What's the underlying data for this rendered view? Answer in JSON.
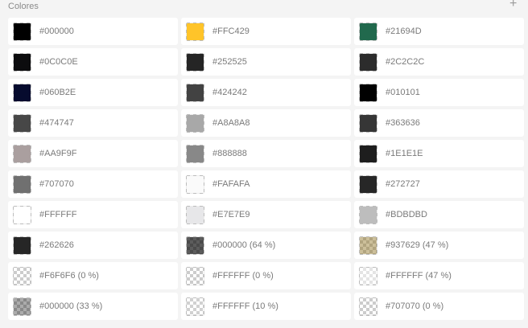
{
  "header": {
    "title": "Colores",
    "add_icon": "plus-icon"
  },
  "colors": [
    {
      "label": "#000000",
      "hex": "#000000",
      "alpha": 1
    },
    {
      "label": "#FFC429",
      "hex": "#FFC429",
      "alpha": 1
    },
    {
      "label": "#21694D",
      "hex": "#21694D",
      "alpha": 1
    },
    {
      "label": "#0C0C0E",
      "hex": "#0C0C0E",
      "alpha": 1
    },
    {
      "label": "#252525",
      "hex": "#252525",
      "alpha": 1
    },
    {
      "label": "#2C2C2C",
      "hex": "#2C2C2C",
      "alpha": 1
    },
    {
      "label": "#060B2E",
      "hex": "#060B2E",
      "alpha": 1
    },
    {
      "label": "#424242",
      "hex": "#424242",
      "alpha": 1
    },
    {
      "label": "#010101",
      "hex": "#010101",
      "alpha": 1
    },
    {
      "label": "#474747",
      "hex": "#474747",
      "alpha": 1
    },
    {
      "label": "#A8A8A8",
      "hex": "#A8A8A8",
      "alpha": 1
    },
    {
      "label": "#363636",
      "hex": "#363636",
      "alpha": 1
    },
    {
      "label": "#AA9F9F",
      "hex": "#AA9F9F",
      "alpha": 1
    },
    {
      "label": "#888888",
      "hex": "#888888",
      "alpha": 1
    },
    {
      "label": "#1E1E1E",
      "hex": "#1E1E1E",
      "alpha": 1
    },
    {
      "label": "#707070",
      "hex": "#707070",
      "alpha": 1
    },
    {
      "label": "#FAFAFA",
      "hex": "#FAFAFA",
      "alpha": 1
    },
    {
      "label": "#272727",
      "hex": "#272727",
      "alpha": 1
    },
    {
      "label": "#FFFFFF",
      "hex": "#FFFFFF",
      "alpha": 1
    },
    {
      "label": "#E7E7E9",
      "hex": "#E7E7E9",
      "alpha": 1
    },
    {
      "label": "#BDBDBD",
      "hex": "#BDBDBD",
      "alpha": 1
    },
    {
      "label": "#262626",
      "hex": "#262626",
      "alpha": 1
    },
    {
      "label": "#000000 (64 %)",
      "hex": "#000000",
      "alpha": 0.64
    },
    {
      "label": "#937629 (47 %)",
      "hex": "#937629",
      "alpha": 0.47
    },
    {
      "label": "#F6F6F6 (0 %)",
      "hex": "#F6F6F6",
      "alpha": 0
    },
    {
      "label": "#FFFFFF (0 %)",
      "hex": "#FFFFFF",
      "alpha": 0
    },
    {
      "label": "#FFFFFF (47 %)",
      "hex": "#FFFFFF",
      "alpha": 0.47
    },
    {
      "label": "#000000 (33 %)",
      "hex": "#000000",
      "alpha": 0.33
    },
    {
      "label": "#FFFFFF (10 %)",
      "hex": "#FFFFFF",
      "alpha": 0.1
    },
    {
      "label": "#707070 (0 %)",
      "hex": "#707070",
      "alpha": 0
    }
  ]
}
